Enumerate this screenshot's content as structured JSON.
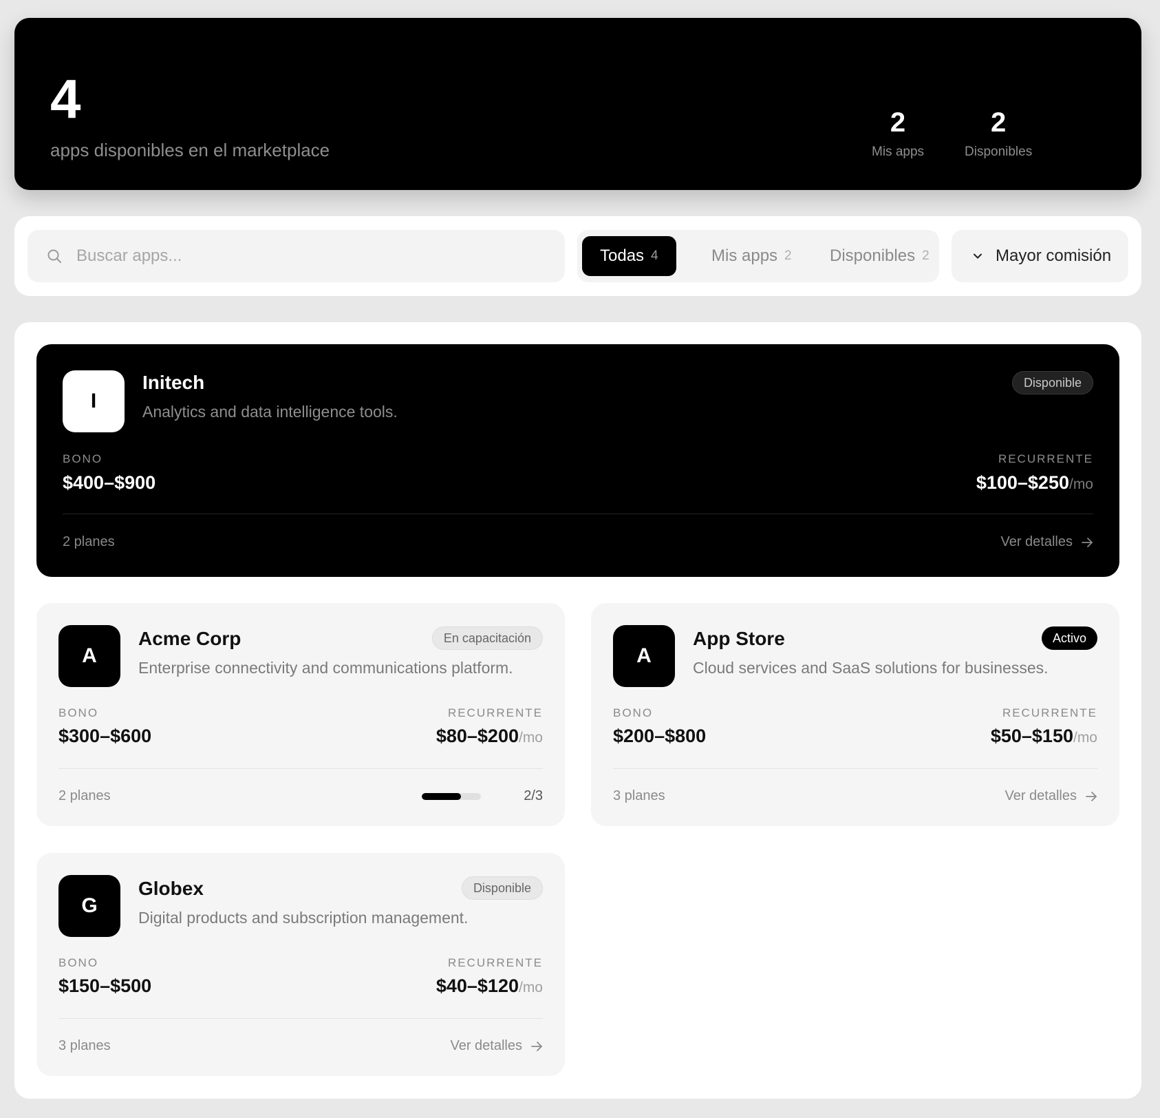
{
  "hero": {
    "count": "4",
    "subtitle": "apps disponibles en el marketplace",
    "stats": [
      {
        "value": "2",
        "label": "Mis apps"
      },
      {
        "value": "2",
        "label": "Disponibles"
      }
    ]
  },
  "search": {
    "placeholder": "Buscar apps...",
    "icon": "search-icon"
  },
  "tabs": [
    {
      "label": "Todas",
      "count": "4",
      "active": true
    },
    {
      "label": "Mis apps",
      "count": "2",
      "active": false
    },
    {
      "label": "Disponibles",
      "count": "2",
      "active": false
    }
  ],
  "sort": {
    "label": "Mayor comisión",
    "icon": "chevron-down-icon"
  },
  "apps": [
    {
      "initial": "I",
      "name": "Initech",
      "description": "Analytics and data intelligence tools.",
      "badge": "Disponible",
      "bonus_label": "BONO",
      "bonus": "$400–$900",
      "recurring_label": "RECURRENTE",
      "recurring": "$100–$250",
      "per": "/mo",
      "plans": "2 planes",
      "action": "Ver detalles"
    },
    {
      "initial": "A",
      "name": "Acme Corp",
      "description": "Enterprise connectivity and communications platform.",
      "badge": "En capacitación",
      "bonus_label": "BONO",
      "bonus": "$300–$600",
      "recurring_label": "RECURRENTE",
      "recurring": "$80–$200",
      "per": "/mo",
      "plans": "2 planes",
      "progress": {
        "text": "2/3",
        "fraction": 0.6667
      }
    },
    {
      "initial": "A",
      "name": "App Store",
      "description": "Cloud services and SaaS solutions for businesses.",
      "badge": "Activo",
      "bonus_label": "BONO",
      "bonus": "$200–$800",
      "recurring_label": "RECURRENTE",
      "recurring": "$50–$150",
      "per": "/mo",
      "plans": "3 planes",
      "action": "Ver detalles"
    },
    {
      "initial": "G",
      "name": "Globex",
      "description": "Digital products and subscription management.",
      "badge": "Disponible",
      "bonus_label": "BONO",
      "bonus": "$150–$500",
      "recurring_label": "RECURRENTE",
      "recurring": "$40–$120",
      "per": "/mo",
      "plans": "3 planes",
      "action": "Ver detalles"
    }
  ]
}
